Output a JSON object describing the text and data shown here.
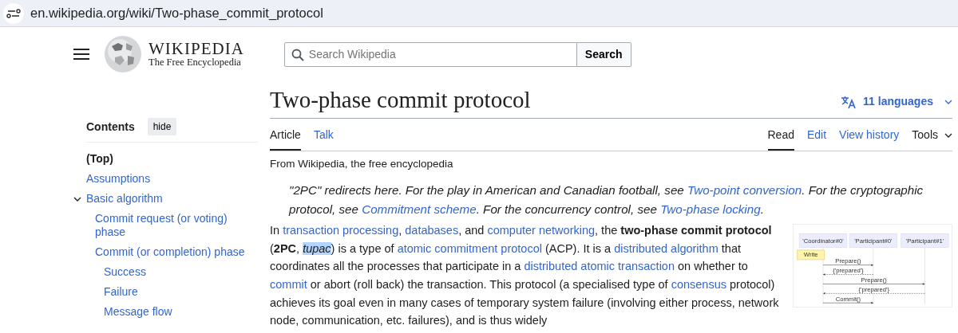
{
  "address_bar": {
    "url": "en.wikipedia.org/wiki/Two-phase_commit_protocol"
  },
  "header": {
    "wordmark": "WIKIPEDIA",
    "tagline": "The Free Encyclopedia",
    "search": {
      "placeholder": "Search Wikipedia",
      "button": "Search"
    }
  },
  "title": "Two-phase commit protocol",
  "languages": "11 languages",
  "toc": {
    "heading": "Contents",
    "hide_button": "hide",
    "items": [
      {
        "label": "(Top)",
        "selected": true
      },
      {
        "label": "Assumptions",
        "selected": false
      },
      {
        "label": "Basic algorithm",
        "selected": false,
        "expanded": true,
        "children": [
          {
            "label": "Commit request (or voting) phase",
            "selected": false
          },
          {
            "label": "Commit (or completion) phase",
            "selected": false,
            "children": [
              {
                "label": "Success",
                "selected": false
              },
              {
                "label": "Failure",
                "selected": false
              },
              {
                "label": "Message flow",
                "selected": false
              }
            ]
          }
        ]
      }
    ]
  },
  "left_tabs": [
    {
      "label": "Article",
      "selected": true
    },
    {
      "label": "Talk",
      "selected": false
    }
  ],
  "right_tabs": [
    {
      "label": "Read",
      "selected": true
    },
    {
      "label": "Edit",
      "selected": false
    },
    {
      "label": "View history",
      "selected": false
    }
  ],
  "tools": "Tools",
  "tagline": "From Wikipedia, the free encyclopedia",
  "hatnote": [
    {
      "kind": "text",
      "text": "\"2PC\" redirects here. For the play in American and Canadian football, see "
    },
    {
      "kind": "link",
      "text": "Two-point conversion"
    },
    {
      "kind": "text",
      "text": ". For the cryptographic protocol, see "
    },
    {
      "kind": "link",
      "text": "Commitment scheme"
    },
    {
      "kind": "text",
      "text": ". For the concurrency control, see "
    },
    {
      "kind": "link",
      "text": "Two-phase locking"
    },
    {
      "kind": "text",
      "text": "."
    }
  ],
  "paragraph": [
    {
      "kind": "text",
      "text": "In "
    },
    {
      "kind": "link",
      "text": "transaction processing"
    },
    {
      "kind": "text",
      "text": ", "
    },
    {
      "kind": "link",
      "text": "databases"
    },
    {
      "kind": "text",
      "text": ", and "
    },
    {
      "kind": "link",
      "text": "computer networking"
    },
    {
      "kind": "text",
      "text": ", the "
    },
    {
      "kind": "bold",
      "text": "two-phase commit protocol"
    },
    {
      "kind": "text",
      "text": " ("
    },
    {
      "kind": "bold",
      "text": "2PC"
    },
    {
      "kind": "text",
      "text": ", "
    },
    {
      "kind": "highlight",
      "text": "tupac"
    },
    {
      "kind": "text",
      "text": ") is a type of "
    },
    {
      "kind": "link",
      "text": "atomic commitment protocol"
    },
    {
      "kind": "text",
      "text": " (ACP). It is a "
    },
    {
      "kind": "link",
      "text": "distributed algorithm"
    },
    {
      "kind": "text",
      "text": " that coordinates all the processes that participate in a "
    },
    {
      "kind": "link",
      "text": "distributed atomic transaction"
    },
    {
      "kind": "text",
      "text": " on whether to "
    },
    {
      "kind": "link",
      "text": "commit"
    },
    {
      "kind": "text",
      "text": " or abort (roll back) the transaction. This protocol (a specialised type of "
    },
    {
      "kind": "link",
      "text": "consensus"
    },
    {
      "kind": "text",
      "text": " protocol) achieves its goal even in many cases of temporary system failure (involving either process, network node, communication, etc. failures), and is thus widely"
    }
  ],
  "diagram": {
    "participants": [
      "'Coordinator#0'",
      "'Participant#0'",
      "'Participant#1'"
    ],
    "note": "Write",
    "messages": [
      {
        "label": "Prepare()",
        "kind": "call"
      },
      {
        "label": "{'prepared'}",
        "kind": "reply"
      },
      {
        "label": "Prepare()",
        "kind": "call"
      },
      {
        "label": "{'prepared'}",
        "kind": "reply"
      },
      {
        "label": "Commit()",
        "kind": "call"
      }
    ]
  }
}
